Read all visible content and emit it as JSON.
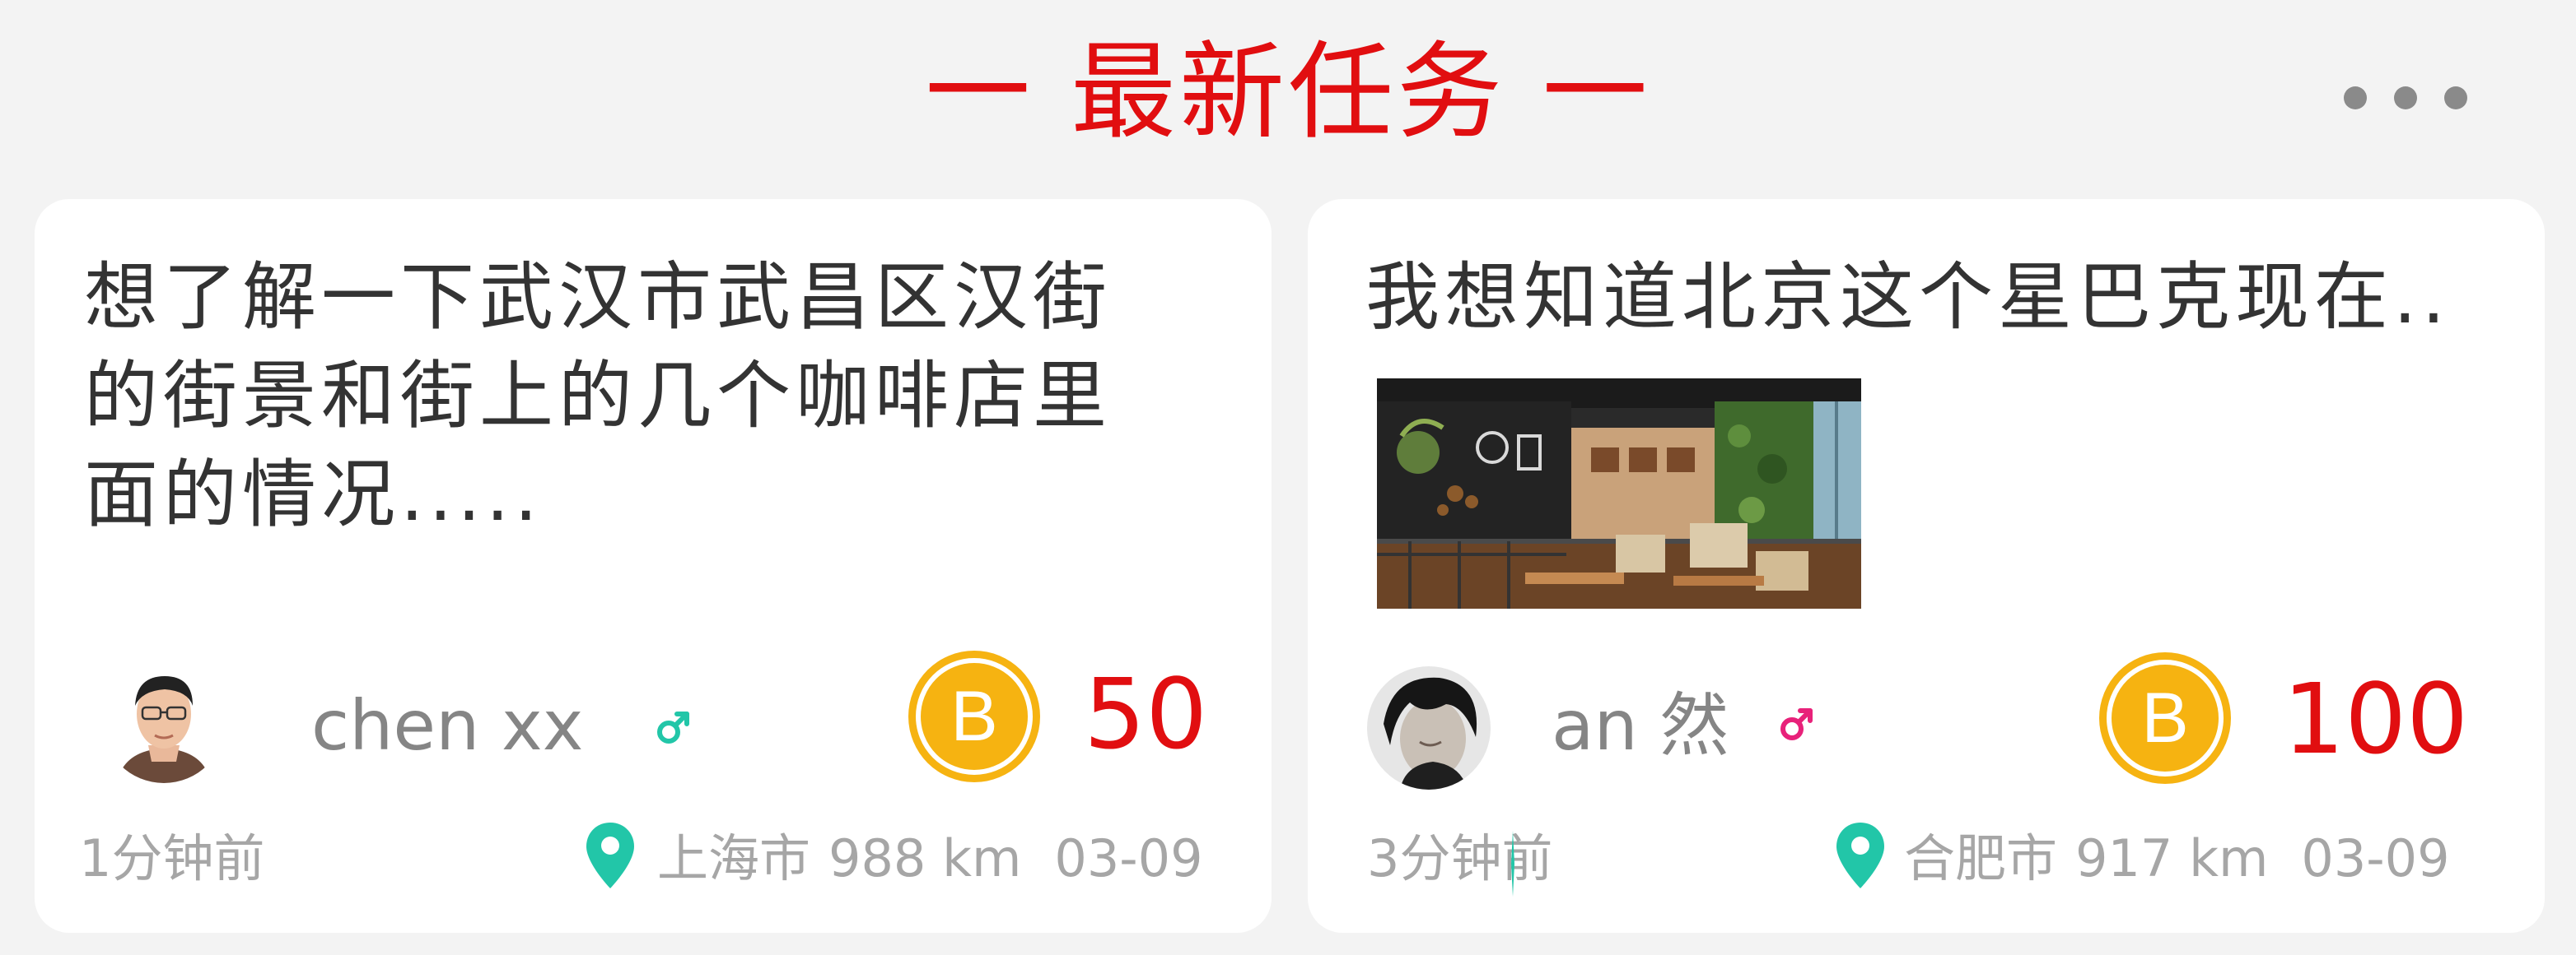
{
  "header": {
    "title": "一 最新任务 一",
    "more_icon": "more-dots-icon"
  },
  "colors": {
    "accent_red": "#e10e10",
    "coin_gold": "#f6b311",
    "location_teal": "#22c6a8",
    "male_teal": "#22c6a8",
    "male_pink": "#e8217a",
    "text_dark": "#333333",
    "text_gray": "#858585",
    "text_light": "#a6a6a6",
    "background": "#f3f3f3"
  },
  "tasks": [
    {
      "text": "想了解一下武汉市武昌区汉街\n的街景和街上的几个咖啡店里\n面的情况.....",
      "username": "chen xx",
      "gender_icon": "male-icon",
      "coin_icon": "coin-b-icon",
      "coin_letter": "B",
      "reward": "50",
      "time_ago": "1分钟前",
      "location_icon": "location-pin-icon",
      "city": "上海市",
      "distance": "988 km",
      "date": "03-09"
    },
    {
      "text": "我想知道北京这个星巴克现在..",
      "username": "an 然",
      "gender_icon": "male-icon",
      "coin_icon": "coin-b-icon",
      "coin_letter": "B",
      "reward": "100",
      "time_ago": "3分钟前",
      "location_icon": "location-pin-icon",
      "city": "合肥市",
      "distance": "917 km",
      "date": "03-09"
    }
  ]
}
